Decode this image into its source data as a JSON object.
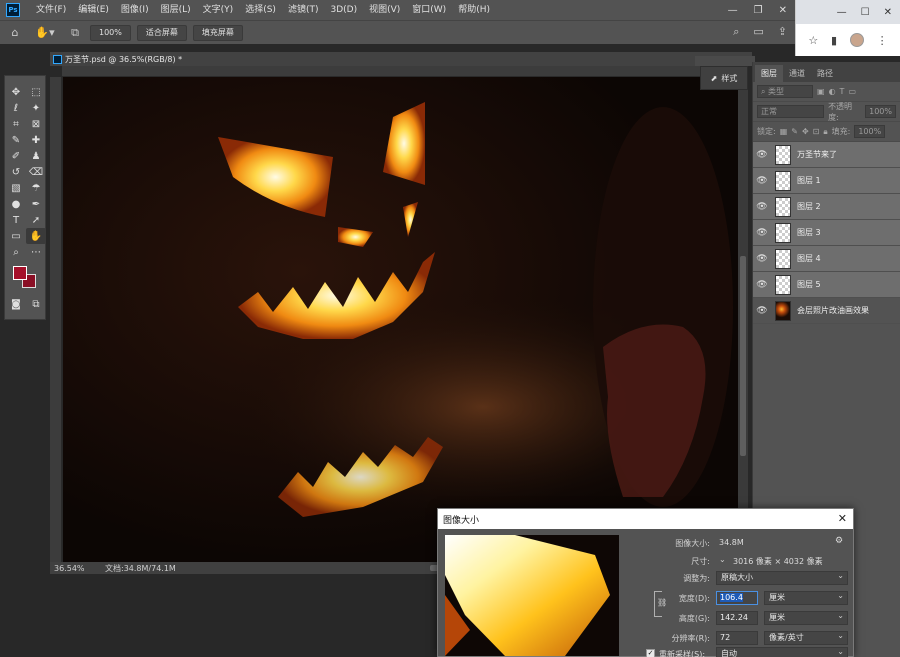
{
  "menu": {
    "logo": "Ps",
    "items": [
      "文件(F)",
      "编辑(E)",
      "图像(I)",
      "图层(L)",
      "文字(Y)",
      "选择(S)",
      "滤镜(T)",
      "3D(D)",
      "视图(V)",
      "窗口(W)",
      "帮助(H)"
    ],
    "window_controls": [
      "—",
      "❐",
      "✕"
    ]
  },
  "options": {
    "zoom": "100%",
    "fit_screen": "适合屏幕",
    "fill_screen": "填充屏幕"
  },
  "document": {
    "tab_title": "万圣节.psd @ 36.5%(RGB/8) *",
    "zoom": "36.54%",
    "doc_info": "文档:34.8M/74.1M"
  },
  "style_panel": {
    "label": "样式"
  },
  "layers_panel": {
    "tabs": [
      "图层",
      "通道",
      "路径"
    ],
    "filter_placeholder": "类型",
    "blend_mode": "正常",
    "opacity_label": "不透明度:",
    "opacity_value": "100%",
    "lock_label": "锁定:",
    "fill_label": "填充:",
    "fill_value": "100%",
    "layers": [
      {
        "name": "万圣节来了",
        "visible": true
      },
      {
        "name": "图层 1",
        "visible": true
      },
      {
        "name": "图层 2",
        "visible": true
      },
      {
        "name": "图层 3",
        "visible": true
      },
      {
        "name": "图层 4",
        "visible": true
      },
      {
        "name": "图层 5",
        "visible": true
      },
      {
        "name": "会层照片改油画效果",
        "visible": true
      }
    ]
  },
  "dialog": {
    "title": "图像大小",
    "image_size_label": "图像大小:",
    "image_size_value": "34.8M",
    "dimensions_label": "尺寸:",
    "dimensions_value": "3016 像素 × 4032 像素",
    "fit_label": "调整为:",
    "fit_value": "原稿大小",
    "width_label": "宽度(D):",
    "width_value": "106.4",
    "width_unit": "厘米",
    "height_label": "高度(G):",
    "height_value": "142.24",
    "height_unit": "厘米",
    "resolution_label": "分辨率(R):",
    "resolution_value": "72",
    "resolution_unit": "像素/英寸",
    "resample_label": "重新采样(S):",
    "resample_value": "自动"
  }
}
